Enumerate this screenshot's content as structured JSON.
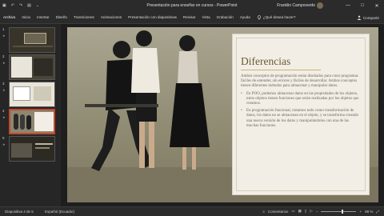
{
  "window": {
    "title": "Presentación para enseñar en cursos - PowerPoint",
    "user": "Franklin Campoverde",
    "controls": [
      "—",
      "□",
      "✕"
    ]
  },
  "ribbon": {
    "tabs": [
      "Archivo",
      "Inicio",
      "Insertar",
      "Diseño",
      "Transiciones",
      "Animaciones",
      "Presentación con diapositivas",
      "Revisar",
      "Vista",
      "Grabación",
      "Ayuda"
    ],
    "search_label": "¿Qué desea hacer?",
    "share_label": "Compartir"
  },
  "thumbnails": [
    {
      "num": "1",
      "selected": false
    },
    {
      "num": "2",
      "selected": false
    },
    {
      "num": "3",
      "selected": false
    },
    {
      "num": "4",
      "selected": true
    },
    {
      "num": "5",
      "selected": false
    }
  ],
  "slide": {
    "title": "Diferencias",
    "intro": "Ambos conceptos de programación están diseñados para crear programas fáciles de entender, sin errores y fáciles de desarrollar. Ambos conceptos tienen diferentes métodos para almacenar y manipular datos.",
    "bullets": [
      "En POO, podemos almacenar datos en las propiedades de los objetos, estos objetos tienen funciones que serán realizadas por los objetos que creamos.",
      "En programación funcional, tratamos todo como transformación de datos, los datos no se almacenan en el objeto, y se transforma creando una nueva versión de los datos y manipulándolos con una de las muchas funciones."
    ]
  },
  "statusbar": {
    "slide_info": "Diapositiva 4 de 5",
    "language": "Español (Ecuador)",
    "comments": "Comentarios",
    "zoom": "98 %"
  }
}
